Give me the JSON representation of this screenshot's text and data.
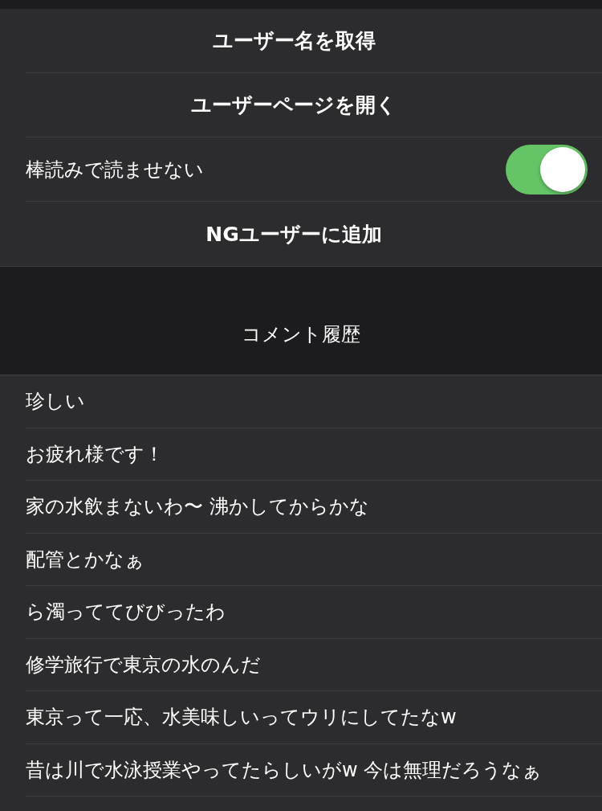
{
  "actions": [
    {
      "kind": "button",
      "label": "ユーザー名を取得"
    },
    {
      "kind": "button",
      "label": "ユーザーページを開く"
    },
    {
      "kind": "toggle",
      "label": "棒読みで読ませない",
      "on": true
    },
    {
      "kind": "button",
      "label": "NGユーザーに追加"
    }
  ],
  "comment_history": {
    "title": "コメント履歴",
    "comments": [
      "珍しい",
      "お疲れ様です！",
      "家の水飲まないわ〜 沸かしてからかな",
      "配管とかなぁ",
      "ら濁っててびびったわ",
      "修学旅行で東京の水のんだ",
      "東京って一応、水美味しいってウリにしてたなw",
      "昔は川で水泳授業やってたらしいがw 今は無理だろうなぁ"
    ]
  }
}
